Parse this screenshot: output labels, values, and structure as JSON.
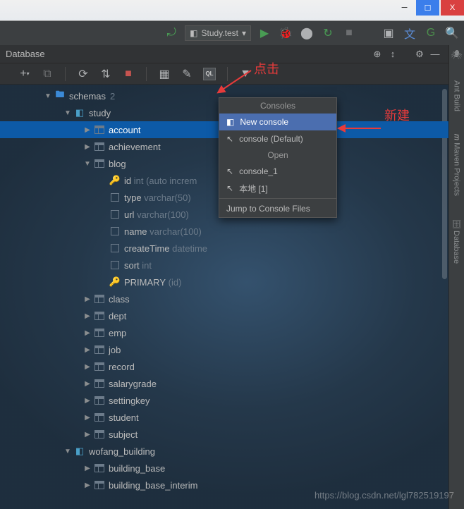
{
  "titlebar": {
    "min": "─",
    "max": "☐",
    "close": "X"
  },
  "toolbar": {
    "hammer": "⤾",
    "build_combo_icon": "◧",
    "build_combo_label": "Study.test",
    "run": "▶",
    "debug": "🐞",
    "stop": "■"
  },
  "panel": {
    "title": "Database",
    "hdr_icons": {
      "scope": "⊕",
      "settings_mini": "↕",
      "gear": "⚙",
      "min": "—"
    },
    "tool": {
      "add": "+",
      "duplicate": "⧉",
      "refresh": "⟳",
      "sync": "⇅",
      "stop": "■",
      "table": "▦",
      "edit": "✎",
      "ql": "QL",
      "filter": "▼"
    }
  },
  "tree": {
    "schemas_label": "schemas",
    "schemas_count": "2",
    "study": {
      "name": "study",
      "tables": {
        "account": "account",
        "achievement": "achievement",
        "blog": {
          "name": "blog",
          "cols": {
            "id": {
              "n": "id",
              "t": "int (auto increm"
            },
            "type": {
              "n": "type",
              "t": "varchar(50)"
            },
            "url": {
              "n": "url",
              "t": "varchar(100)"
            },
            "name": {
              "n": "name",
              "t": "varchar(100)"
            },
            "createTime": {
              "n": "createTime",
              "t": "datetime"
            },
            "sort": {
              "n": "sort",
              "t": "int"
            },
            "primary": {
              "n": "PRIMARY",
              "t": "(id)"
            }
          }
        },
        "class": "class",
        "dept": "dept",
        "emp": "emp",
        "job": "job",
        "record": "record",
        "salarygrade": "salarygrade",
        "settingkey": "settingkey",
        "student": "student",
        "subject": "subject"
      }
    },
    "wofang": {
      "name": "wofang_building",
      "tables": {
        "bb": "building_base",
        "bbi": "building_base_interim"
      }
    }
  },
  "context": {
    "consoles": "Consoles",
    "new_console": "New console",
    "console_default": "console (Default)",
    "open": "Open",
    "console_1": "console_1",
    "local_1": "本地 [1]",
    "jump": "Jump to Console Files"
  },
  "right_tabs": {
    "ant": "Ant Build",
    "maven": "Maven Projects",
    "db": "Database"
  },
  "annotation": {
    "click": "点击",
    "new": "新建"
  },
  "watermark": "https://blog.csdn.net/lgl782519197",
  "menu_icons": {
    "ql": "◧",
    "arrow": "↖"
  }
}
